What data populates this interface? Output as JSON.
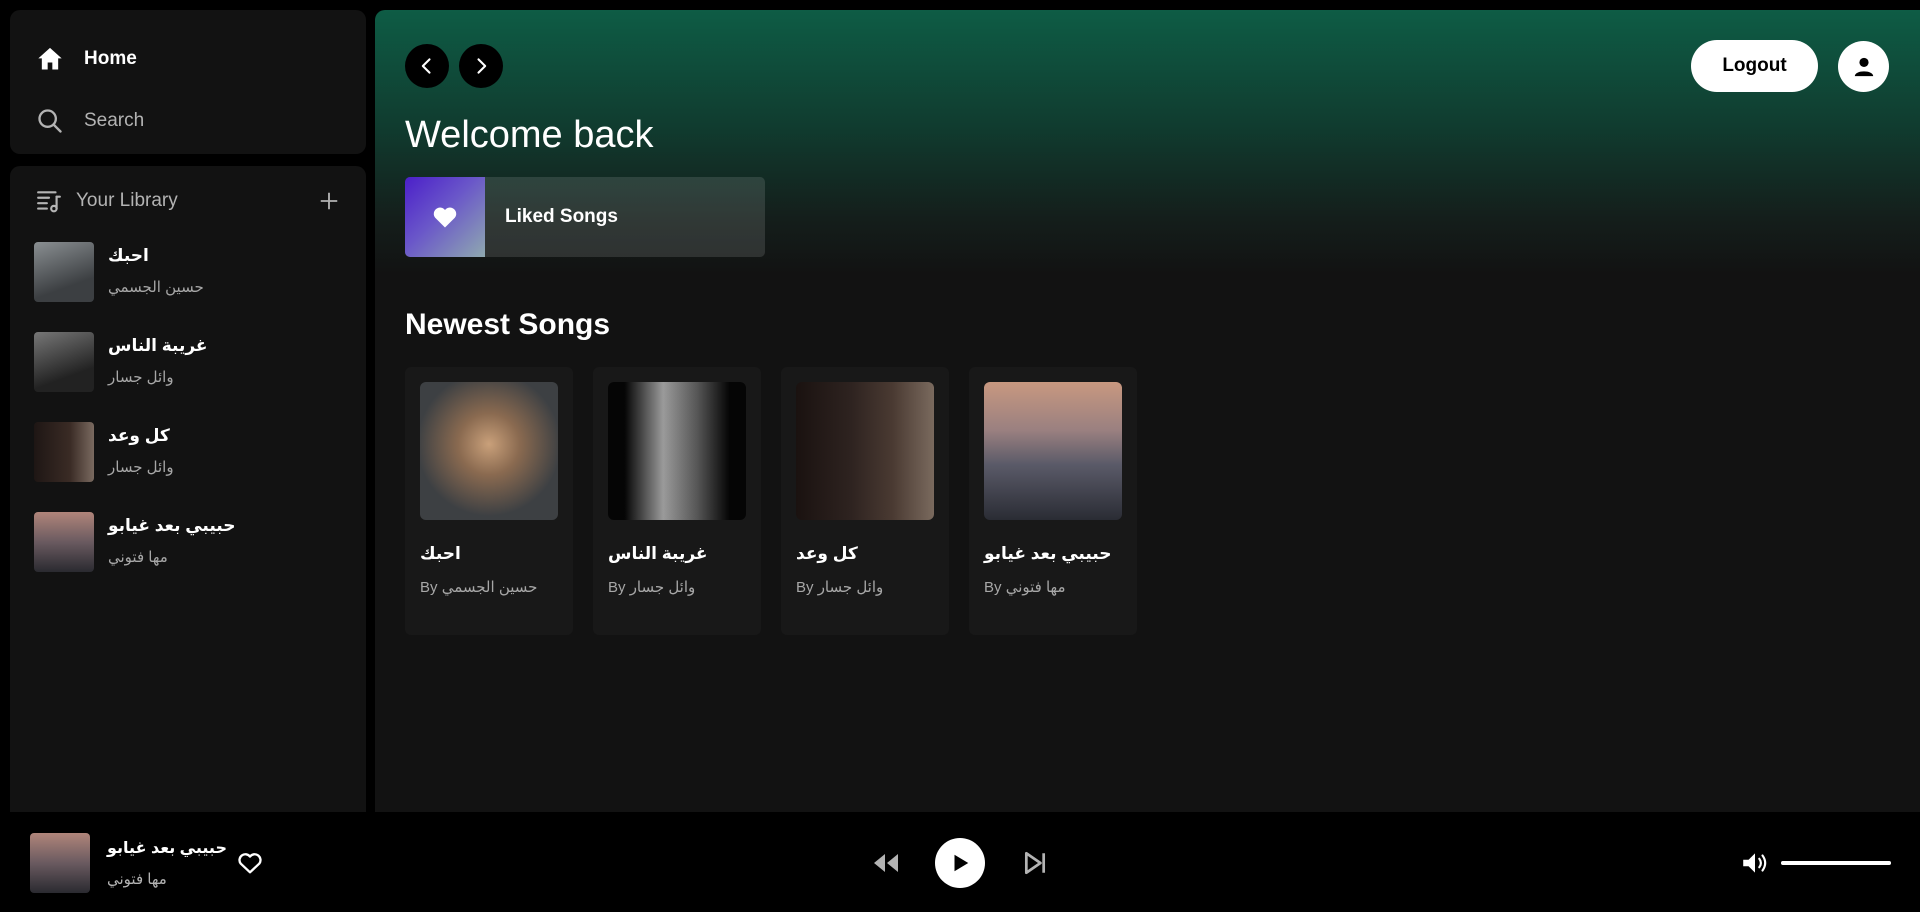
{
  "nav": {
    "home_label": "Home",
    "search_label": "Search"
  },
  "library": {
    "title": "Your Library",
    "items": [
      {
        "name": "احبك",
        "artist": "حسين الجسمي",
        "thumb_color": "#6b6e70"
      },
      {
        "name": "غريبة الناس",
        "artist": "وائل جسار",
        "thumb_color": "#4a4a4a"
      },
      {
        "name": "كل وعد",
        "artist": "وائل جسار",
        "thumb_color": "#2a1f1c"
      },
      {
        "name": "حبيبي بعد غيابو",
        "artist": "مها فتوني",
        "thumb_color": "#5a4a50"
      }
    ]
  },
  "header": {
    "logout_label": "Logout",
    "welcome": "Welcome back",
    "liked_songs_label": "Liked Songs"
  },
  "newest": {
    "title": "Newest Songs",
    "songs": [
      {
        "name": "احبك",
        "by": "By حسين الجسمي"
      },
      {
        "name": "غريبة الناس",
        "by": "By وائل جسار"
      },
      {
        "name": "كل وعد",
        "by": "By وائل جسار"
      },
      {
        "name": "حبيبي بعد غيابو",
        "by": "By مها فتوني"
      }
    ]
  },
  "player": {
    "title": "حبيبي بعد غيابو",
    "artist": "مها فتوني",
    "volume": 1.0
  },
  "colors": {
    "accent": "#0e5c45",
    "background": "#121212"
  },
  "icons": [
    "home-icon",
    "search-icon",
    "library-icon",
    "plus-icon",
    "chevron-left-icon",
    "chevron-right-icon",
    "user-icon",
    "heart-icon",
    "previous-icon",
    "play-icon",
    "next-icon",
    "volume-icon"
  ]
}
